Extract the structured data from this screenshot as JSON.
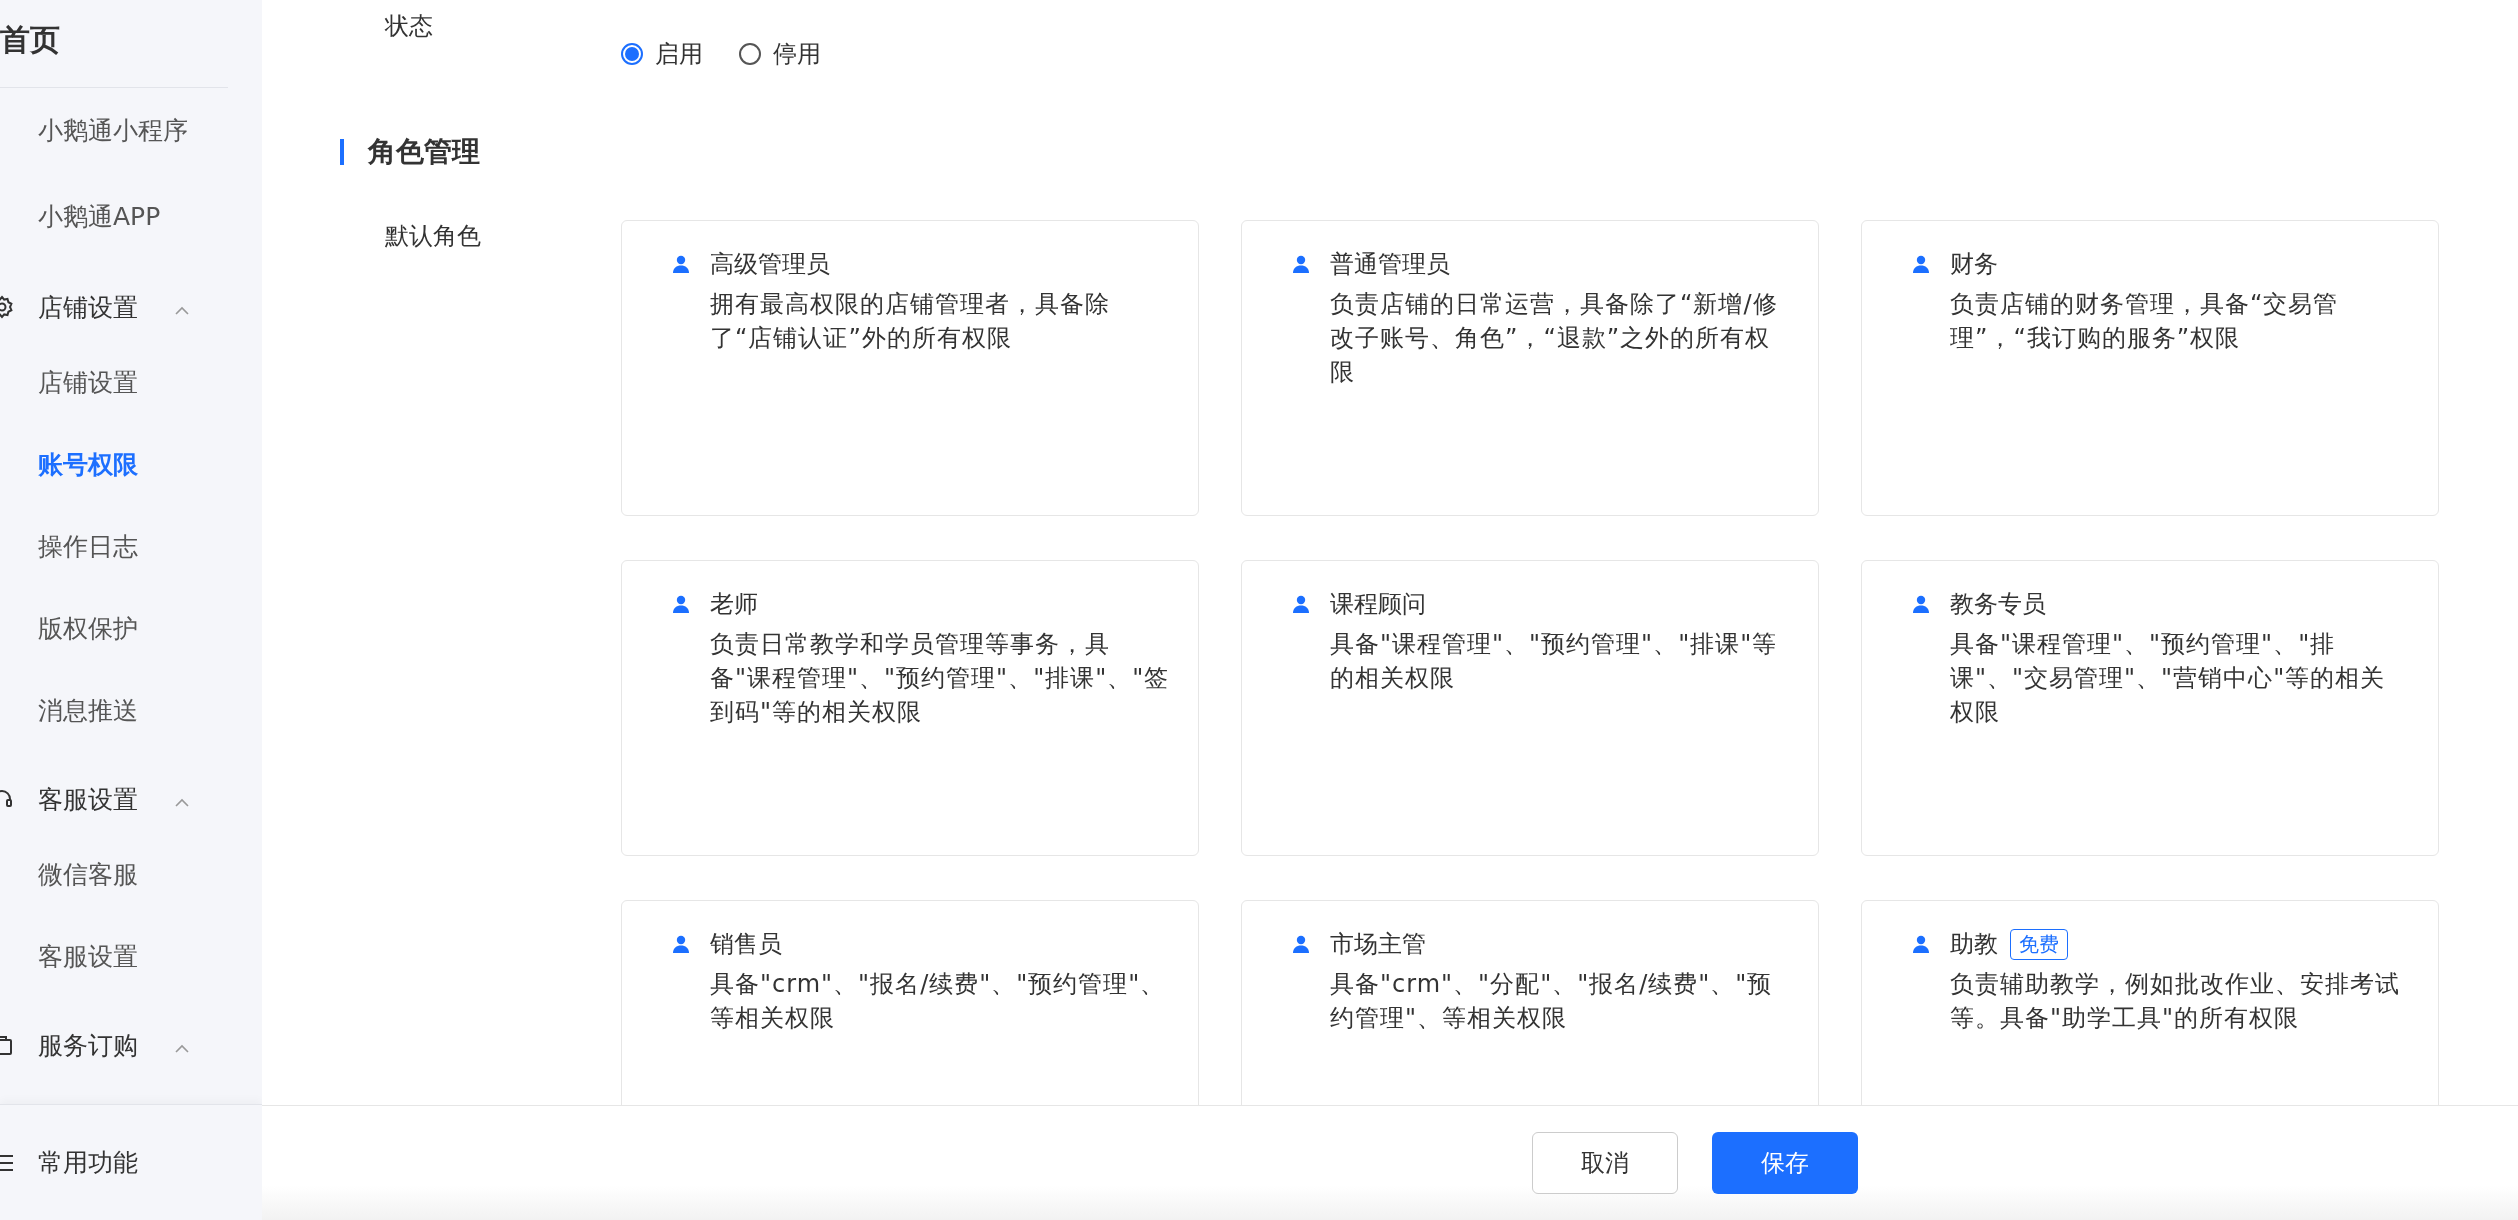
{
  "sidebar": {
    "home": "首页",
    "top_items": [
      {
        "label": "小鹅通小程序",
        "selected": false
      },
      {
        "label": "小鹅通APP",
        "selected": false
      }
    ],
    "groups": [
      {
        "label": "店铺设置",
        "kind": "settings",
        "expanded": true,
        "items": [
          {
            "label": "店铺设置",
            "selected": false
          },
          {
            "label": "账号权限",
            "selected": true
          },
          {
            "label": "操作日志",
            "selected": false
          },
          {
            "label": "版权保护",
            "selected": false
          },
          {
            "label": "消息推送",
            "selected": false
          }
        ]
      },
      {
        "label": "客服设置",
        "kind": "service",
        "expanded": true,
        "items": [
          {
            "label": "微信客服",
            "selected": false
          },
          {
            "label": "客服设置",
            "selected": false
          }
        ]
      },
      {
        "label": "服务订购",
        "kind": "store",
        "expanded": true
      }
    ],
    "bottom": {
      "label": "常用功能"
    }
  },
  "status": {
    "label": "状态",
    "options": [
      {
        "label": "启用",
        "selected": true
      },
      {
        "label": "停用",
        "selected": false
      }
    ]
  },
  "section_title": "角色管理",
  "roles": {
    "label": "默认角色",
    "cards": [
      {
        "title": "高级管理员",
        "description": "拥有最高权限的店铺管理者，具备除了“店铺认证”外的所有权限"
      },
      {
        "title": "普通管理员",
        "description": "负责店铺的日常运营，具备除了“新增/修改子账号、角色”，“退款”之外的所有权限"
      },
      {
        "title": "财务",
        "description": "负责店铺的财务管理，具备“交易管理”，“我订购的服务”权限"
      },
      {
        "title": "老师",
        "description": "负责日常教学和学员管理等事务，具备\"课程管理\"、\"预约管理\"、\"排课\"、\"签到码\"等的相关权限"
      },
      {
        "title": "课程顾问",
        "description": "具备\"课程管理\"、\"预约管理\"、\"排课\"等的相关权限"
      },
      {
        "title": "教务专员",
        "description": "具备\"课程管理\"、\"预约管理\"、\"排课\"、\"交易管理\"、\"营销中心\"等的相关权限"
      },
      {
        "title": "销售员",
        "description": "具备\"crm\"、\"报名/续费\"、\"预约管理\"、等相关权限"
      },
      {
        "title": "市场主管",
        "description": "具备\"crm\"、\"分配\"、\"报名/续费\"、\"预约管理\"、等相关权限"
      },
      {
        "title": "助教",
        "badge": "免费",
        "description": "负责辅助教学，例如批改作业、安排考试等。具备\"助学工具\"的所有权限"
      }
    ]
  },
  "buttons": [
    {
      "label": "取消",
      "kind": "secondary"
    },
    {
      "label": "保存",
      "kind": "primary"
    }
  ]
}
